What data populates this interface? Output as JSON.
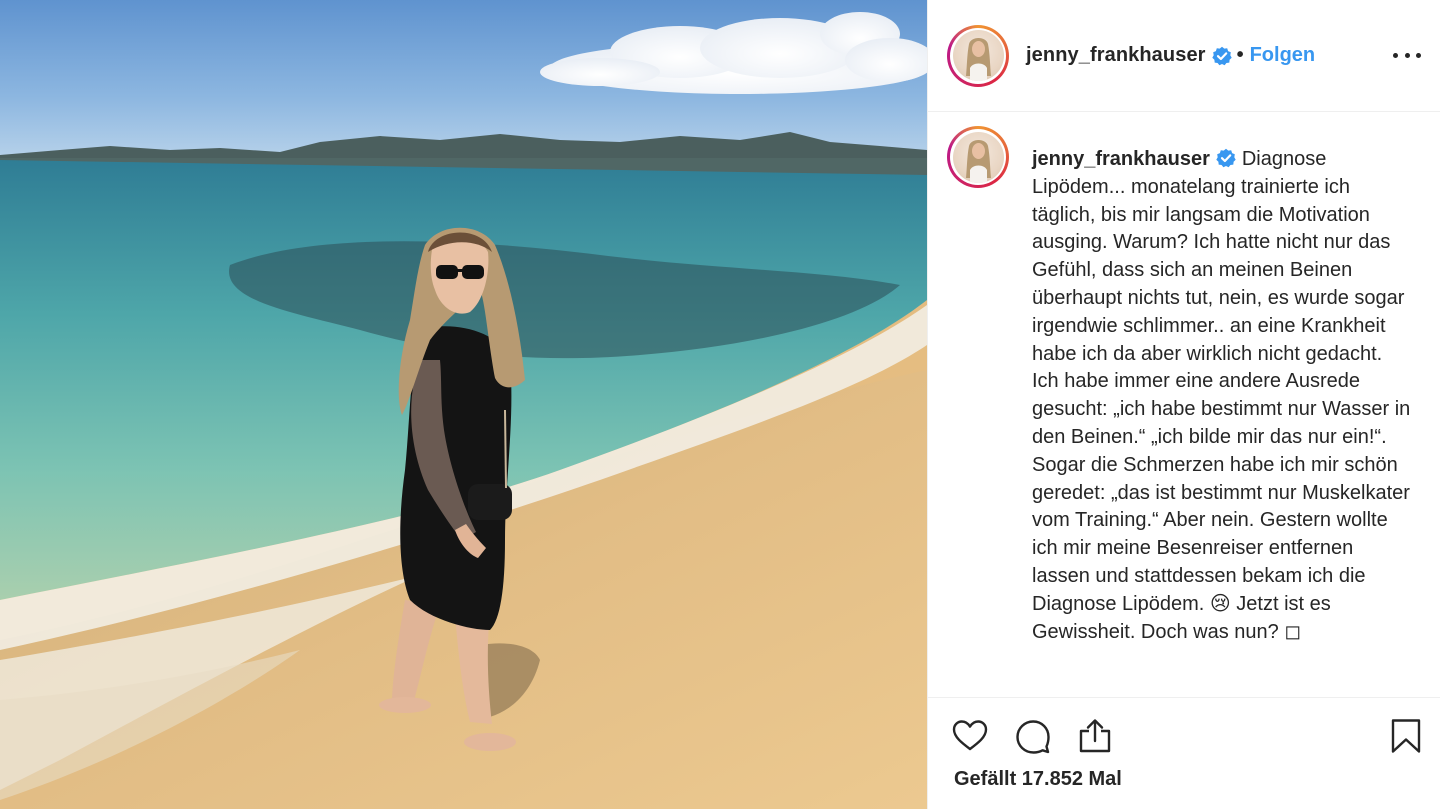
{
  "post": {
    "username": "jenny_frankhauser",
    "verified": true,
    "separator": "•",
    "follow_label": "Folgen",
    "caption": "Diagnose Lipödem... monatelang trainierte ich täglich, bis mir langsam die Motivation ausging. Warum? Ich hatte nicht nur das Gefühl, dass sich an meinen Beinen überhaupt nichts tut, nein, es wurde sogar irgendwie schlimmer.. an eine Krankheit habe ich da aber wirklich nicht gedacht. Ich habe immer eine andere Ausrede gesucht: „ich habe bestimmt nur Wasser in den Beinen.“ „ich bilde mir das nur ein!“. Sogar die Schmerzen habe ich mir schön geredet: „das ist bestimmt nur Muskelkater vom Training.“ Aber nein. Gestern wollte ich mir meine Besenreiser entfernen lassen und stattdessen bekam ich die Diagnose Lipödem. 😢 Jetzt ist es Gewissheit. Doch was nun? ◻",
    "likes_text": "Gefällt 17.852 Mal"
  },
  "icons": {
    "verified": "verified-badge-icon",
    "more": "more-options-icon",
    "like": "heart-icon",
    "comment": "comment-icon",
    "share": "share-icon",
    "save": "bookmark-icon"
  },
  "colors": {
    "link_blue": "#3897f0",
    "verified_blue": "#3897f0",
    "text": "#262626",
    "border": "#efefef"
  }
}
